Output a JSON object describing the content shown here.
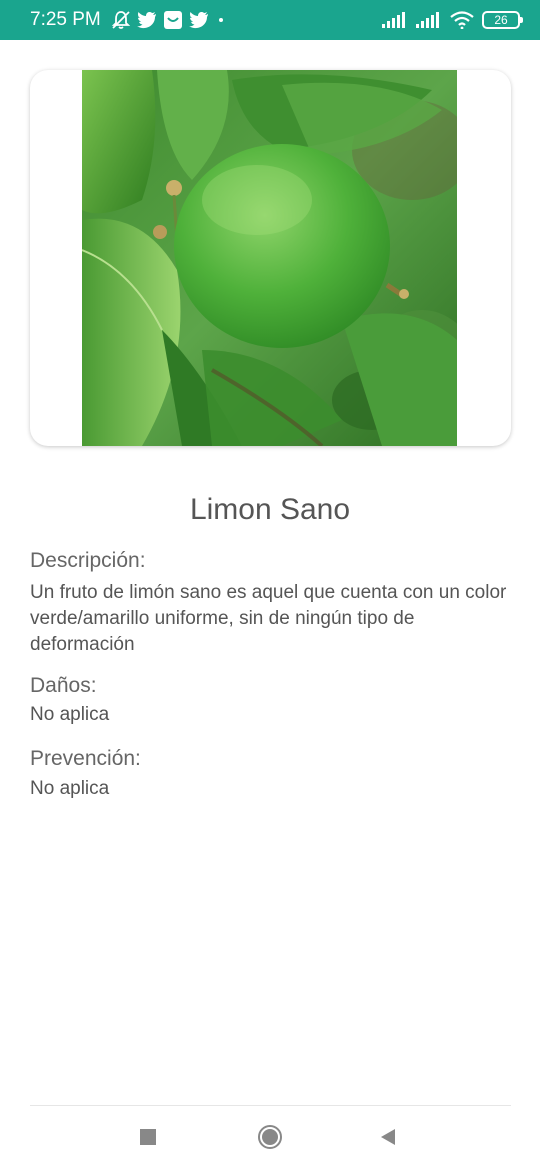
{
  "status_bar": {
    "time": "7:25 PM",
    "battery": "26",
    "icons": [
      "mute-bell-icon",
      "twitter-icon",
      "store-icon",
      "twitter-icon",
      "dot-icon",
      "signal-icon",
      "signal-icon",
      "wifi-icon",
      "battery-icon"
    ],
    "background_color": "#1aa58e"
  },
  "detail": {
    "title": "Limon Sano",
    "description_label": "Descripción:",
    "description_text": "Un fruto de limón sano es aquel que cuenta con un color verde/amarillo uniforme, sin de ningún tipo de deformación",
    "damage_label": "Daños:",
    "damage_text": "No aplica",
    "prevention_label": "Prevención:",
    "prevention_text": "No aplica"
  },
  "nav_bar": {
    "icons": [
      "recents-square-icon",
      "home-circle-icon",
      "back-triangle-icon"
    ]
  }
}
